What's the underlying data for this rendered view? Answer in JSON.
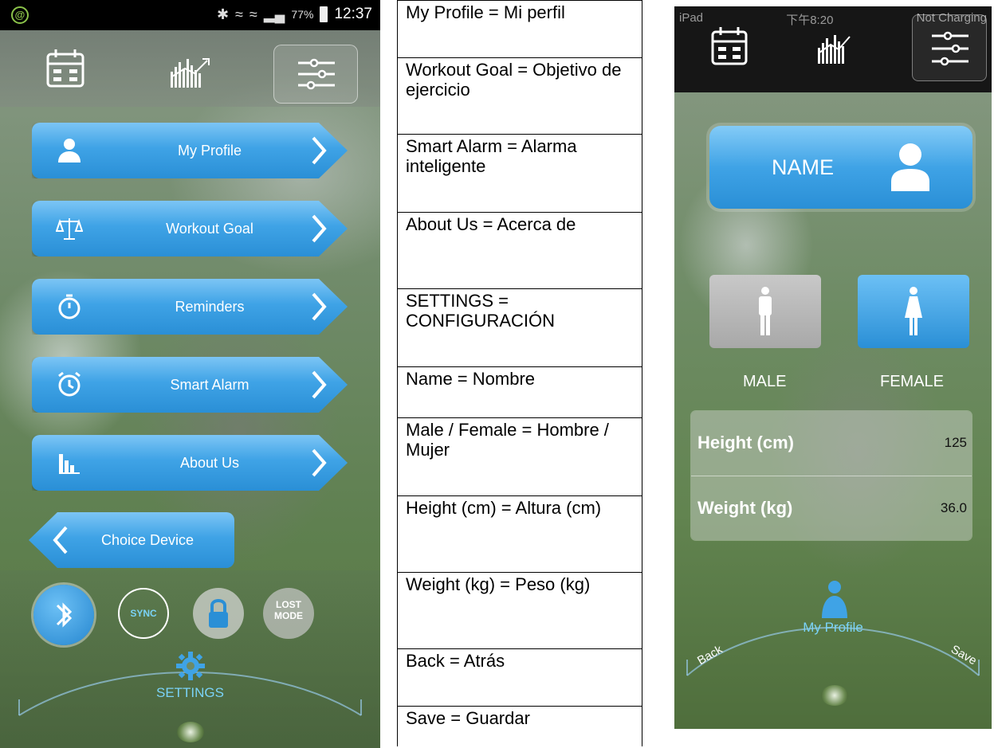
{
  "left_screen": {
    "status_bar": {
      "battery": "77%",
      "time": "12:37"
    },
    "menu": [
      {
        "label": "My Profile",
        "icon": "person-icon"
      },
      {
        "label": "Workout Goal",
        "icon": "scale-icon"
      },
      {
        "label": "Reminders",
        "icon": "stopwatch-icon"
      },
      {
        "label": "Smart Alarm",
        "icon": "alarm-clock-icon"
      },
      {
        "label": "About Us",
        "icon": "bar-chart-icon"
      }
    ],
    "choice_device": {
      "label": "Choice Device"
    },
    "dock": {
      "sync_label": "SYNC",
      "lost_mode_label_1": "LOST",
      "lost_mode_label_2": "MODE",
      "settings_label": "SETTINGS"
    }
  },
  "translations": [
    "My Profile = Mi perfil",
    "Workout Goal = Objetivo de ejercicio",
    "Smart Alarm = Alarma inteligente",
    "About Us = Acerca de",
    "SETTINGS = CONFIGURACIÓN",
    "Name = Nombre",
    "Male / Female = Hombre / Mujer",
    "Height (cm) = Altura (cm)",
    "Weight (kg) = Peso (kg)",
    "Back = Atrás",
    "Save = Guardar"
  ],
  "right_screen": {
    "status_bar": {
      "device": "iPad",
      "time": "下午8:20",
      "charging": "Not Charging"
    },
    "name_button": {
      "label": "NAME"
    },
    "gender": {
      "male_label": "MALE",
      "female_label": "FEMALE",
      "selected": "FEMALE"
    },
    "height": {
      "label": "Height (cm)",
      "value": "125"
    },
    "weight": {
      "label": "Weight (kg)",
      "value": "36.0"
    },
    "bottom": {
      "title": "My Profile",
      "back_label": "Back",
      "save_label": "Save"
    }
  },
  "colors": {
    "accent_blue": "#3fa3e6",
    "dark_bar": "#161616",
    "label_cyan": "#7ad3f7"
  }
}
